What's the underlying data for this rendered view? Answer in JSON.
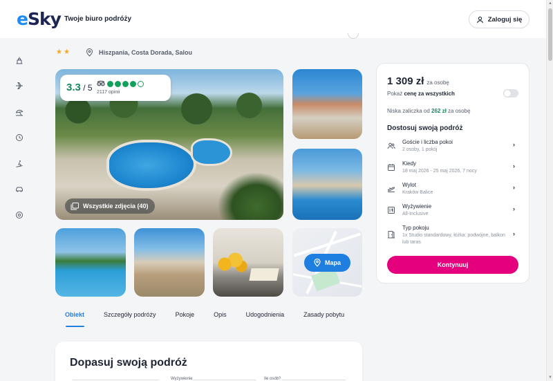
{
  "header": {
    "logo_e": "e",
    "logo_rest": "Sky",
    "tagline": "Twoje biuro podróży",
    "login_label": "Zaloguj się"
  },
  "rail": {
    "icons": [
      "hotel-icon",
      "plane-icon",
      "beach-umbrella-icon",
      "clock-icon",
      "ski-icon",
      "car-icon",
      "globe-icon"
    ]
  },
  "hotel": {
    "stars": "★★",
    "location": "Hiszpania, Costa Dorada, Salou"
  },
  "rating": {
    "value": "3.3",
    "max": "/ 5",
    "count": "2117 opinii",
    "bubbles_filled": 4,
    "bubbles_total": 5
  },
  "gallery": {
    "all_photos_label": "Wszystkie zdjęcia (40)",
    "map_label": "Mapa"
  },
  "tabs": [
    "Obiekt",
    "Szczegóły podróży",
    "Pokoje",
    "Opis",
    "Udogodnienia",
    "Zasady pobytu"
  ],
  "bottom": {
    "title": "Dopasuj swoją podróż",
    "field1_label": "Wyżywienie",
    "field2_label": "Ile osób?"
  },
  "sidebar": {
    "price": "1 309 zł",
    "price_unit": "za osobę",
    "toggle_prefix": "Pokaż ",
    "toggle_bold": "cenę za wszystkich",
    "deposit_prefix": "Niska zaliczka od ",
    "deposit_amount": "262 zł",
    "deposit_suffix": " za osobę",
    "customize_title": "Dostosuj swoją podróż",
    "options": [
      {
        "title": "Goście i liczba pokoi",
        "value": "2 osoby, 1 pokój"
      },
      {
        "title": "Kiedy",
        "value": "18 maj 2026 - 25 maj 2026, 7 nocy"
      },
      {
        "title": "Wylot",
        "value": "Kraków Balice"
      },
      {
        "title": "Wyżywienie",
        "value": "All-Inclusive"
      },
      {
        "title": "Typ pokoju",
        "value": "1x Studio standardowy, łóżka: podwójne, balkon lub taras"
      }
    ],
    "continue_label": "Kontynuuj"
  },
  "colors": {
    "accent_blue": "#1e7fe0",
    "brand_pink": "#e5007e",
    "rating_green": "#168a5c",
    "star_orange": "#f6a623"
  }
}
